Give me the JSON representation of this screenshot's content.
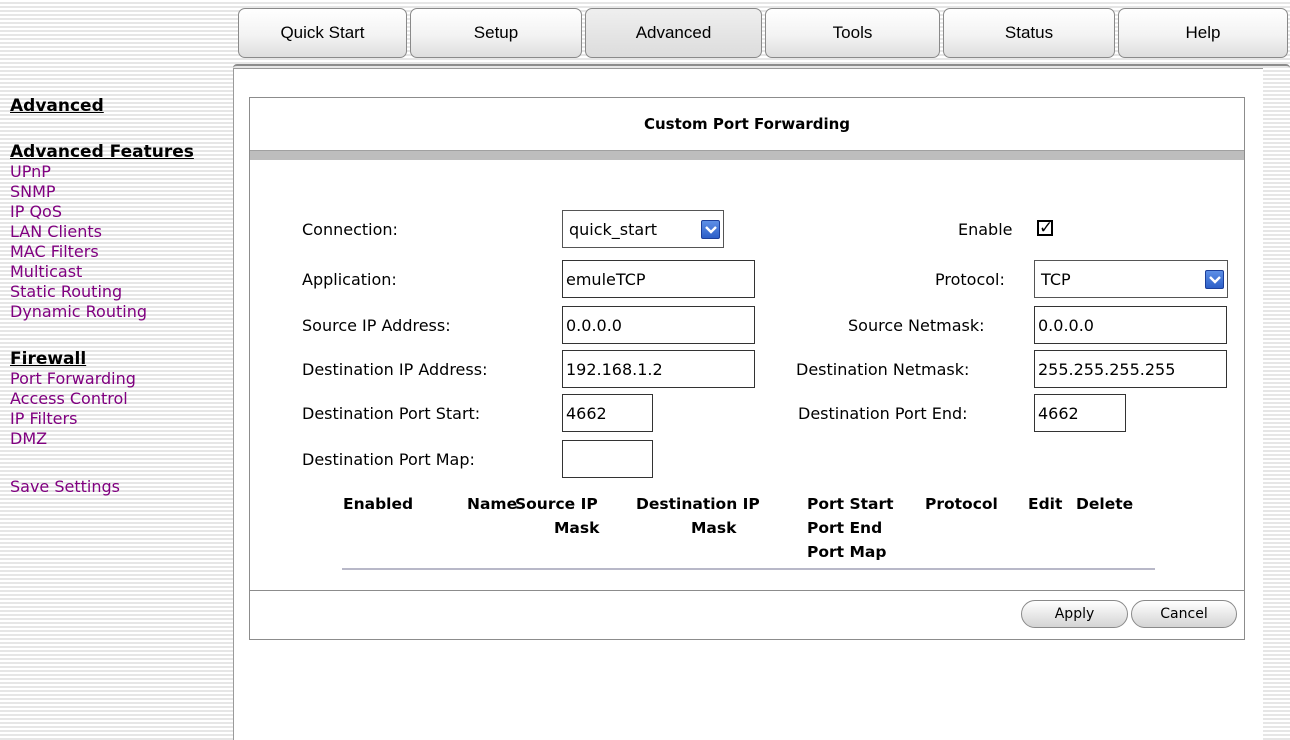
{
  "tabs": [
    {
      "label": "Quick Start"
    },
    {
      "label": "Setup"
    },
    {
      "label": "Advanced"
    },
    {
      "label": "Tools"
    },
    {
      "label": "Status"
    },
    {
      "label": "Help"
    }
  ],
  "active_tab": "Advanced",
  "sidebar": {
    "heading": "Advanced",
    "features_heading": "Advanced Features",
    "features": [
      "UPnP",
      "SNMP",
      "IP QoS",
      "LAN Clients",
      "MAC Filters",
      "Multicast",
      "Static Routing",
      "Dynamic Routing"
    ],
    "firewall_heading": "Firewall",
    "firewall": [
      "Port Forwarding",
      "Access Control",
      "IP Filters",
      "DMZ"
    ],
    "save": "Save Settings"
  },
  "form": {
    "title": "Custom Port Forwarding",
    "connection_label": "Connection:",
    "connection_value": "quick_start",
    "enable_label": "Enable",
    "enable_checked": true,
    "enable_mark": "✓",
    "application_label": "Application:",
    "application_value": "emuleTCP",
    "protocol_label": "Protocol:",
    "protocol_value": "TCP",
    "source_ip_label": "Source IP Address:",
    "source_ip_value": "0.0.0.0",
    "source_netmask_label": "Source Netmask:",
    "source_netmask_value": "0.0.0.0",
    "dest_ip_label": "Destination IP Address:",
    "dest_ip_value": "192.168.1.2",
    "dest_netmask_label": "Destination Netmask:",
    "dest_netmask_value": "255.255.255.255",
    "dest_port_start_label": "Destination Port Start:",
    "dest_port_start_value": "4662",
    "dest_port_end_label": "Destination Port End:",
    "dest_port_end_value": "4662",
    "dest_port_map_label": "Destination Port Map:",
    "dest_port_map_value": ""
  },
  "table": {
    "enabled": "Enabled",
    "name": "Name",
    "source_ip": "Source IP",
    "source_mask": "Mask",
    "destination_ip": "Destination IP",
    "destination_mask": "Mask",
    "port_start": "Port Start",
    "port_end": "Port End",
    "port_map": "Port Map",
    "protocol": "Protocol",
    "edit": "Edit",
    "delete": "Delete"
  },
  "buttons": {
    "apply": "Apply",
    "cancel": "Cancel"
  },
  "colors": {
    "link": "#800080",
    "dropdown_button": "#2d5fc8"
  }
}
